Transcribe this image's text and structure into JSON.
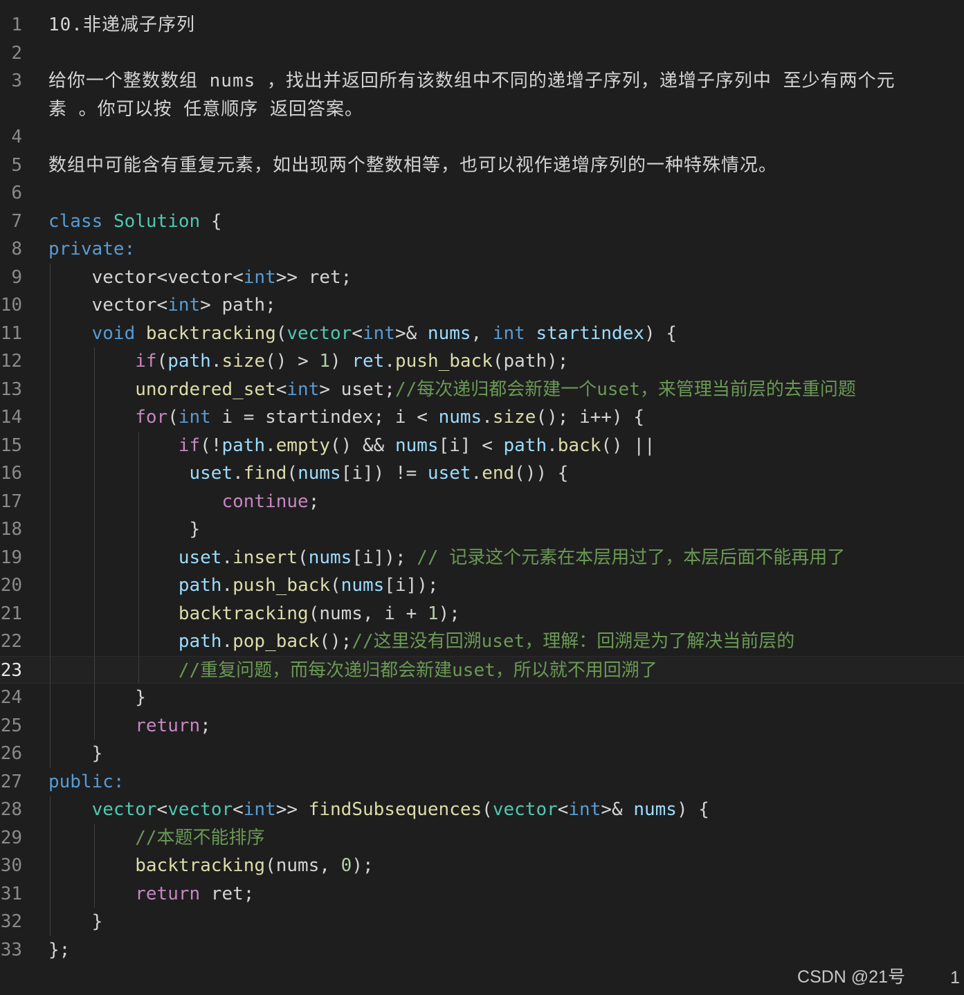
{
  "lines": [
    {
      "num": "1",
      "segs": [
        [
          "d",
          "10.非递减子序列"
        ]
      ]
    },
    {
      "num": "2",
      "segs": []
    },
    {
      "num": "3",
      "segs": [
        [
          "d",
          "给你一个整数数组 nums ，找出并返回所有该数组中不同的递增子序列，递增子序列中 至少有两个元"
        ]
      ]
    },
    {
      "num": "",
      "segs": [
        [
          "d",
          "素 。你可以按 任意顺序 返回答案。"
        ]
      ]
    },
    {
      "num": "4",
      "segs": []
    },
    {
      "num": "5",
      "segs": [
        [
          "d",
          "数组中可能含有重复元素，如出现两个整数相等，也可以视作递增序列的一种特殊情况。"
        ]
      ]
    },
    {
      "num": "6",
      "segs": []
    },
    {
      "num": "7",
      "segs": [
        [
          "k",
          "class"
        ],
        [
          "d",
          " "
        ],
        [
          "t",
          "Solution"
        ],
        [
          "d",
          " {"
        ]
      ]
    },
    {
      "num": "8",
      "segs": [
        [
          "k",
          "private:"
        ]
      ]
    },
    {
      "num": "9",
      "segs": [
        [
          "d",
          "    vector<vector<"
        ],
        [
          "k",
          "int"
        ],
        [
          "d",
          ">> ret;"
        ]
      ]
    },
    {
      "num": "10",
      "segs": [
        [
          "d",
          "    vector<"
        ],
        [
          "k",
          "int"
        ],
        [
          "d",
          "> path;"
        ]
      ]
    },
    {
      "num": "11",
      "segs": [
        [
          "d",
          "    "
        ],
        [
          "k",
          "void"
        ],
        [
          "d",
          " "
        ],
        [
          "f",
          "backtracking"
        ],
        [
          "d",
          "("
        ],
        [
          "t",
          "vector"
        ],
        [
          "d",
          "<"
        ],
        [
          "k",
          "int"
        ],
        [
          "d",
          ">& "
        ],
        [
          "v",
          "nums"
        ],
        [
          "d",
          ", "
        ],
        [
          "k",
          "int"
        ],
        [
          "d",
          " "
        ],
        [
          "v",
          "startindex"
        ],
        [
          "d",
          ") {"
        ]
      ]
    },
    {
      "num": "12",
      "segs": [
        [
          "d",
          "        "
        ],
        [
          "p",
          "if"
        ],
        [
          "d",
          "("
        ],
        [
          "v",
          "path"
        ],
        [
          "d",
          "."
        ],
        [
          "f",
          "size"
        ],
        [
          "d",
          "() > "
        ],
        [
          "n",
          "1"
        ],
        [
          "d",
          ") "
        ],
        [
          "v",
          "ret"
        ],
        [
          "d",
          "."
        ],
        [
          "f",
          "push_back"
        ],
        [
          "d",
          "(path);"
        ]
      ]
    },
    {
      "num": "13",
      "segs": [
        [
          "d",
          "        "
        ],
        [
          "f",
          "unordered_set"
        ],
        [
          "d",
          "<"
        ],
        [
          "k",
          "int"
        ],
        [
          "d",
          "> uset;"
        ],
        [
          "c",
          "//每次递归都会新建一个uset，来管理当前层的去重问题"
        ]
      ]
    },
    {
      "num": "14",
      "segs": [
        [
          "d",
          "        "
        ],
        [
          "p",
          "for"
        ],
        [
          "d",
          "("
        ],
        [
          "k",
          "int"
        ],
        [
          "d",
          " i = startindex; i < "
        ],
        [
          "v",
          "nums"
        ],
        [
          "d",
          "."
        ],
        [
          "f",
          "size"
        ],
        [
          "d",
          "(); i++) {"
        ]
      ]
    },
    {
      "num": "15",
      "segs": [
        [
          "d",
          "            "
        ],
        [
          "p",
          "if"
        ],
        [
          "d",
          "(!"
        ],
        [
          "v",
          "path"
        ],
        [
          "d",
          "."
        ],
        [
          "f",
          "empty"
        ],
        [
          "d",
          "() && "
        ],
        [
          "v",
          "nums"
        ],
        [
          "d",
          "[i] < "
        ],
        [
          "v",
          "path"
        ],
        [
          "d",
          "."
        ],
        [
          "f",
          "back"
        ],
        [
          "d",
          "() ||"
        ]
      ]
    },
    {
      "num": "16",
      "segs": [
        [
          "d",
          "             "
        ],
        [
          "v",
          "uset"
        ],
        [
          "d",
          "."
        ],
        [
          "f",
          "find"
        ],
        [
          "d",
          "("
        ],
        [
          "v",
          "nums"
        ],
        [
          "d",
          "[i]) != "
        ],
        [
          "v",
          "uset"
        ],
        [
          "d",
          "."
        ],
        [
          "f",
          "end"
        ],
        [
          "d",
          "()) {"
        ]
      ]
    },
    {
      "num": "17",
      "segs": [
        [
          "d",
          "                "
        ],
        [
          "p",
          "continue"
        ],
        [
          "d",
          ";"
        ]
      ]
    },
    {
      "num": "18",
      "segs": [
        [
          "d",
          "             }"
        ]
      ]
    },
    {
      "num": "19",
      "segs": [
        [
          "d",
          "            "
        ],
        [
          "v",
          "uset"
        ],
        [
          "d",
          "."
        ],
        [
          "f",
          "insert"
        ],
        [
          "d",
          "("
        ],
        [
          "v",
          "nums"
        ],
        [
          "d",
          "[i]); "
        ],
        [
          "c",
          "// 记录这个元素在本层用过了，本层后面不能再用了"
        ]
      ]
    },
    {
      "num": "20",
      "segs": [
        [
          "d",
          "            "
        ],
        [
          "v",
          "path"
        ],
        [
          "d",
          "."
        ],
        [
          "f",
          "push_back"
        ],
        [
          "d",
          "("
        ],
        [
          "v",
          "nums"
        ],
        [
          "d",
          "[i]);"
        ]
      ]
    },
    {
      "num": "21",
      "segs": [
        [
          "d",
          "            "
        ],
        [
          "f",
          "backtracking"
        ],
        [
          "d",
          "(nums, i + "
        ],
        [
          "n",
          "1"
        ],
        [
          "d",
          ");"
        ]
      ]
    },
    {
      "num": "22",
      "segs": [
        [
          "d",
          "            "
        ],
        [
          "v",
          "path"
        ],
        [
          "d",
          "."
        ],
        [
          "f",
          "pop_back"
        ],
        [
          "d",
          "();"
        ],
        [
          "c",
          "//这里没有回溯uset，理解：回溯是为了解决当前层的"
        ]
      ]
    },
    {
      "num": "23",
      "segs": [
        [
          "d",
          "            "
        ],
        [
          "c",
          "//重复问题，而每次递归都会新建uset，所以就不用回溯了"
        ]
      ]
    },
    {
      "num": "24",
      "segs": [
        [
          "d",
          "        }"
        ]
      ]
    },
    {
      "num": "25",
      "segs": [
        [
          "d",
          "        "
        ],
        [
          "p",
          "return"
        ],
        [
          "d",
          ";"
        ]
      ]
    },
    {
      "num": "26",
      "segs": [
        [
          "d",
          "    }"
        ]
      ]
    },
    {
      "num": "27",
      "segs": [
        [
          "k",
          "public:"
        ]
      ]
    },
    {
      "num": "28",
      "segs": [
        [
          "d",
          "    "
        ],
        [
          "t",
          "vector"
        ],
        [
          "d",
          "<"
        ],
        [
          "t",
          "vector"
        ],
        [
          "d",
          "<"
        ],
        [
          "k",
          "int"
        ],
        [
          "d",
          ">> "
        ],
        [
          "f",
          "findSubsequences"
        ],
        [
          "d",
          "("
        ],
        [
          "t",
          "vector"
        ],
        [
          "d",
          "<"
        ],
        [
          "k",
          "int"
        ],
        [
          "d",
          ">& "
        ],
        [
          "v",
          "nums"
        ],
        [
          "d",
          ") {"
        ]
      ]
    },
    {
      "num": "29",
      "segs": [
        [
          "d",
          "        "
        ],
        [
          "c",
          "//本题不能排序"
        ]
      ]
    },
    {
      "num": "30",
      "segs": [
        [
          "d",
          "        "
        ],
        [
          "f",
          "backtracking"
        ],
        [
          "d",
          "(nums, "
        ],
        [
          "n",
          "0"
        ],
        [
          "d",
          ");"
        ]
      ]
    },
    {
      "num": "31",
      "segs": [
        [
          "d",
          "        "
        ],
        [
          "p",
          "return"
        ],
        [
          "d",
          " ret;"
        ]
      ]
    },
    {
      "num": "32",
      "segs": [
        [
          "d",
          "    }"
        ]
      ]
    },
    {
      "num": "33",
      "segs": [
        [
          "d",
          "};"
        ]
      ]
    }
  ],
  "current_line": "23",
  "watermark": "CSDN @21号",
  "status_number": "1"
}
